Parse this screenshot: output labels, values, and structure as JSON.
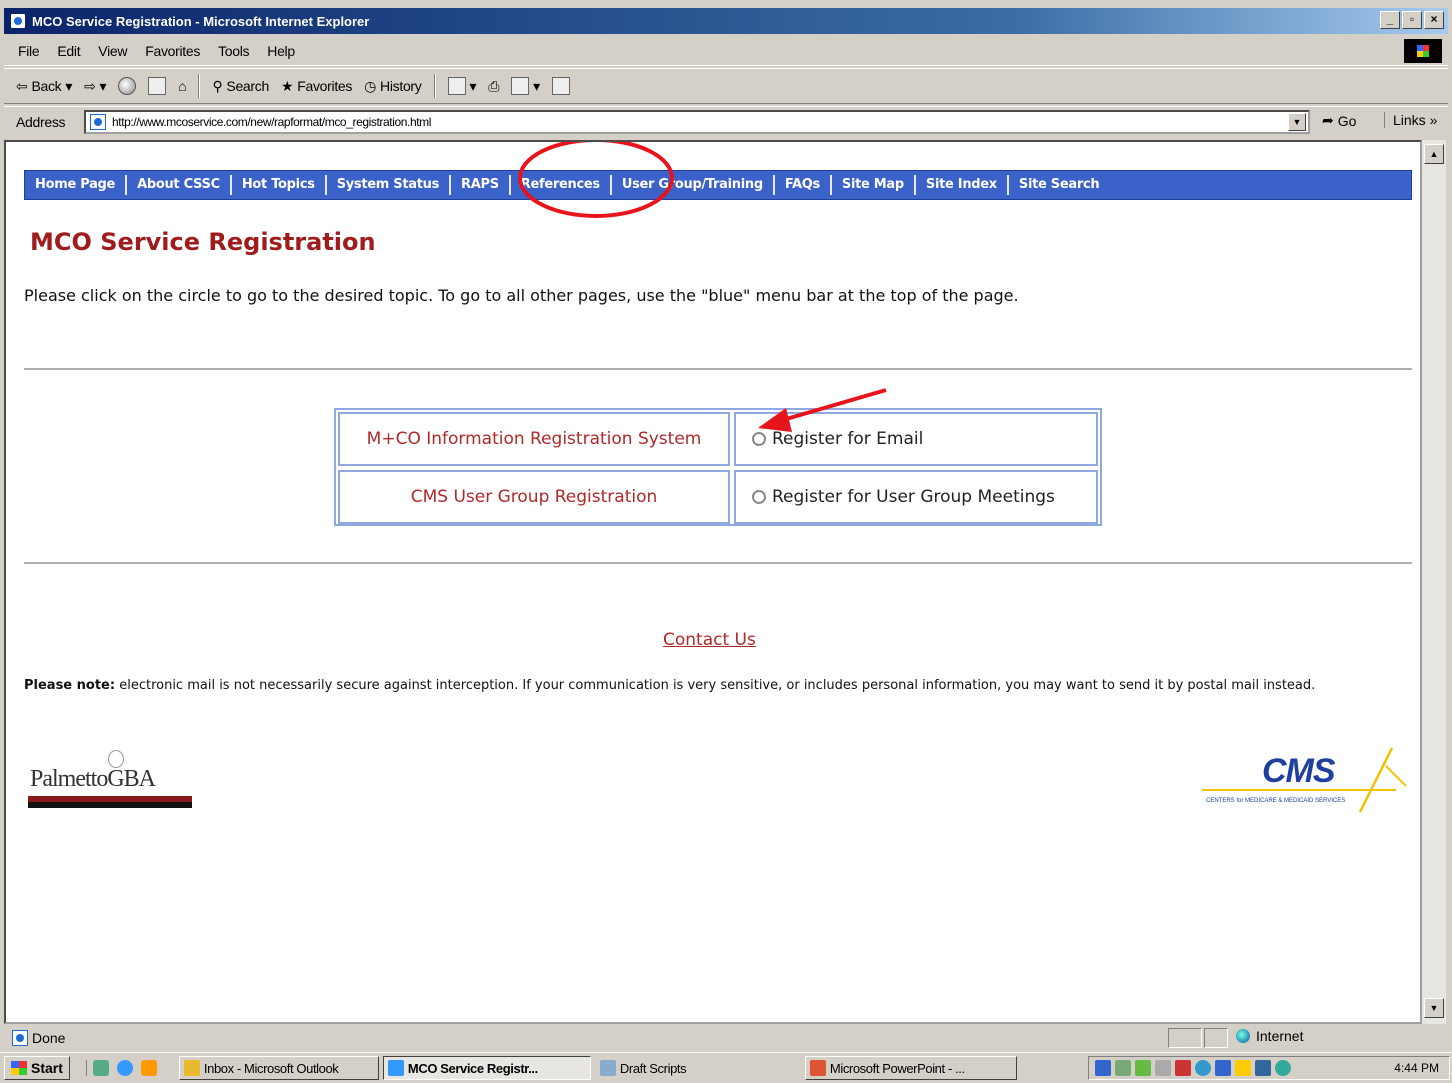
{
  "window": {
    "title": "MCO Service Registration - Microsoft Internet Explorer",
    "buttons": [
      "_",
      "ȅ",
      "x"
    ]
  },
  "menu": [
    "File",
    "Edit",
    "View",
    "Favorites",
    "Tools",
    "Help"
  ],
  "toolbar": {
    "back": "Back",
    "search": "Search",
    "favorites": "Favorites",
    "history": "History"
  },
  "address": {
    "label": "Address",
    "url": "http://www.mcoservice.com/new/rapformat/mco_registration.html",
    "go": "Go",
    "links": "Links"
  },
  "nav": [
    "Home Page",
    "About CSSC",
    "Hot Topics",
    "System Status",
    "RAPS",
    "References",
    "User Group/Training",
    "FAQs",
    "Site Map",
    "Site Index",
    "Site Search"
  ],
  "page": {
    "title": "MCO Service Registration",
    "intro": "Please click on the circle to go to the desired topic. To go to all other pages, use the \"blue\" menu bar at the top of the page.",
    "rows": [
      {
        "label": "M+CO Information Registration System",
        "option": "Register for Email"
      },
      {
        "label": "CMS User Group Registration",
        "option": "Register for User Group Meetings"
      }
    ],
    "contact": "Contact Us",
    "note_bold": "Please note:",
    "note": " electronic mail is not necessarily secure against interception. If your communication is very sensitive, or includes personal information, you may want to send it by postal mail instead.",
    "logo_left": "PalmettoGBA",
    "logo_right": "CMS",
    "logo_right_sub": "CENTERS for MEDICARE & MEDICAID SERVICES"
  },
  "status": {
    "text": "Done",
    "zone": "Internet"
  },
  "taskbar": {
    "start": "Start",
    "tasks": [
      "Inbox - Microsoft Outlook",
      "MCO Service Registr...",
      "Draft Scripts",
      "Microsoft PowerPoint - ..."
    ],
    "clock": "4:44 PM"
  },
  "colors": {
    "nav_blue": "#3a62c8",
    "title_red": "#a01d1d",
    "link_red": "#b02828",
    "annotation_red": "#e8141c"
  }
}
